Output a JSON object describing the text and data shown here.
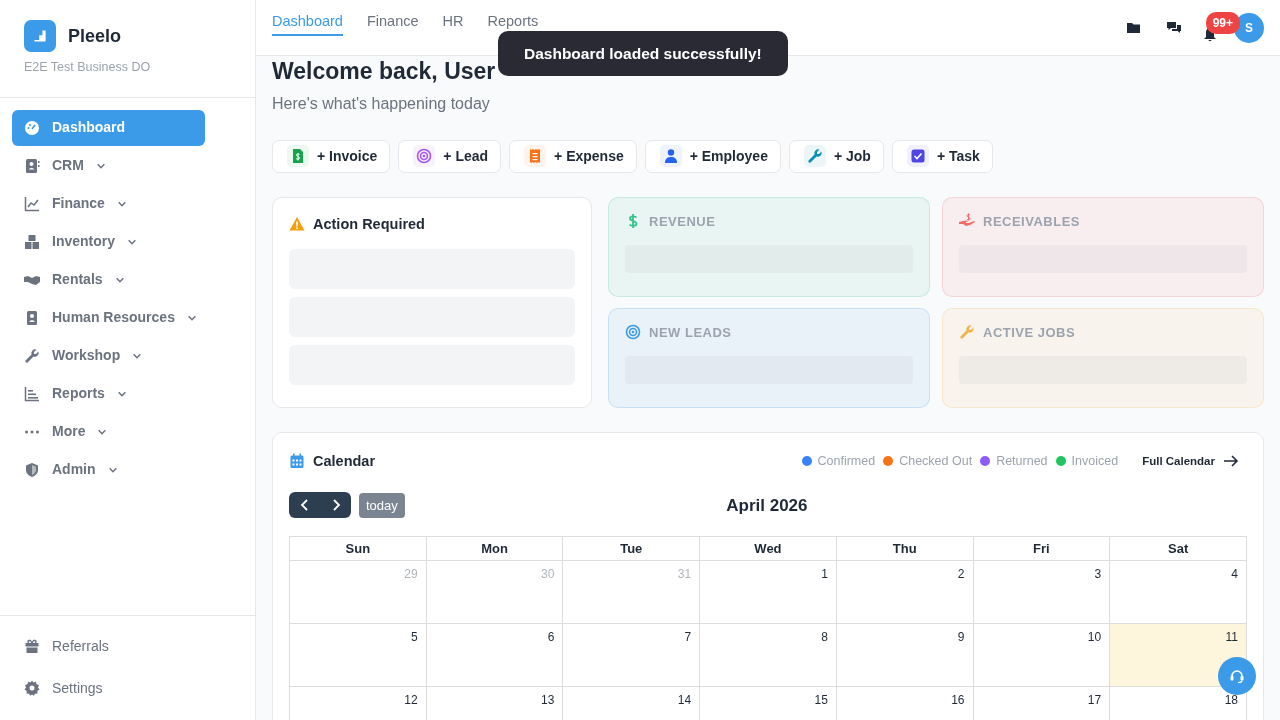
{
  "brand": {
    "name": "Pleelo",
    "business": "E2E Test Business DO"
  },
  "sidebar": {
    "items": [
      {
        "label": "Dashboard",
        "selected": true,
        "expandable": false
      },
      {
        "label": "CRM",
        "selected": false,
        "expandable": true
      },
      {
        "label": "Finance",
        "selected": false,
        "expandable": true
      },
      {
        "label": "Inventory",
        "selected": false,
        "expandable": true
      },
      {
        "label": "Rentals",
        "selected": false,
        "expandable": true
      },
      {
        "label": "Human Resources",
        "selected": false,
        "expandable": true
      },
      {
        "label": "Workshop",
        "selected": false,
        "expandable": true
      },
      {
        "label": "Reports",
        "selected": false,
        "expandable": true
      },
      {
        "label": "More",
        "selected": false,
        "expandable": true
      },
      {
        "label": "Admin",
        "selected": false,
        "expandable": true
      }
    ],
    "footer": [
      {
        "label": "Referrals"
      },
      {
        "label": "Settings"
      }
    ]
  },
  "tabs": [
    {
      "label": "Dashboard",
      "selected": true
    },
    {
      "label": "Finance",
      "selected": false
    },
    {
      "label": "HR",
      "selected": false
    },
    {
      "label": "Reports",
      "selected": false
    }
  ],
  "notifications": {
    "count": "99+"
  },
  "avatar": {
    "initial": "S"
  },
  "toast": {
    "message": "Dashboard loaded successfully!"
  },
  "welcome": {
    "title": "Welcome back, User",
    "subtitle": "Here's what's happening today"
  },
  "quick_actions": [
    {
      "label": "+ Invoice",
      "color": "#16a34a"
    },
    {
      "label": "+ Lead",
      "color": "#a855f7"
    },
    {
      "label": "+ Expense",
      "color": "#f97316"
    },
    {
      "label": "+ Employee",
      "color": "#2563eb"
    },
    {
      "label": "+ Job",
      "color": "#0891b2"
    },
    {
      "label": "+ Task",
      "color": "#4f46e5"
    }
  ],
  "action_required": {
    "title": "Action Required"
  },
  "stats": [
    {
      "label": "REVENUE",
      "color": "#34c38f"
    },
    {
      "label": "RECEIVABLES",
      "color": "#f46a6a"
    },
    {
      "label": "NEW LEADS",
      "color": "#3b9be8"
    },
    {
      "label": "ACTIVE JOBS",
      "color": "#f1b44c"
    }
  ],
  "calendar": {
    "title": "Calendar",
    "month": "April 2026",
    "today_label": "today",
    "full_link": "Full Calendar",
    "legend": [
      {
        "label": "Confirmed",
        "color": "#3b82f6"
      },
      {
        "label": "Checked Out",
        "color": "#f97316"
      },
      {
        "label": "Returned",
        "color": "#8b5cf6"
      },
      {
        "label": "Invoiced",
        "color": "#22c55e"
      }
    ],
    "weekdays": [
      "Sun",
      "Mon",
      "Tue",
      "Wed",
      "Thu",
      "Fri",
      "Sat"
    ],
    "weeks": [
      [
        {
          "day": "29",
          "outside": true,
          "today": false
        },
        {
          "day": "30",
          "outside": true,
          "today": false
        },
        {
          "day": "31",
          "outside": true,
          "today": false
        },
        {
          "day": "1",
          "outside": false,
          "today": false
        },
        {
          "day": "2",
          "outside": false,
          "today": false
        },
        {
          "day": "3",
          "outside": false,
          "today": false
        },
        {
          "day": "4",
          "outside": false,
          "today": false
        }
      ],
      [
        {
          "day": "5",
          "outside": false,
          "today": false
        },
        {
          "day": "6",
          "outside": false,
          "today": false
        },
        {
          "day": "7",
          "outside": false,
          "today": false
        },
        {
          "day": "8",
          "outside": false,
          "today": false
        },
        {
          "day": "9",
          "outside": false,
          "today": false
        },
        {
          "day": "10",
          "outside": false,
          "today": false
        },
        {
          "day": "11",
          "outside": false,
          "today": true
        }
      ],
      [
        {
          "day": "12",
          "outside": false,
          "today": false
        },
        {
          "day": "13",
          "outside": false,
          "today": false
        },
        {
          "day": "14",
          "outside": false,
          "today": false
        },
        {
          "day": "15",
          "outside": false,
          "today": false
        },
        {
          "day": "16",
          "outside": false,
          "today": false
        },
        {
          "day": "17",
          "outside": false,
          "today": false
        },
        {
          "day": "18",
          "outside": false,
          "today": false
        }
      ]
    ]
  }
}
